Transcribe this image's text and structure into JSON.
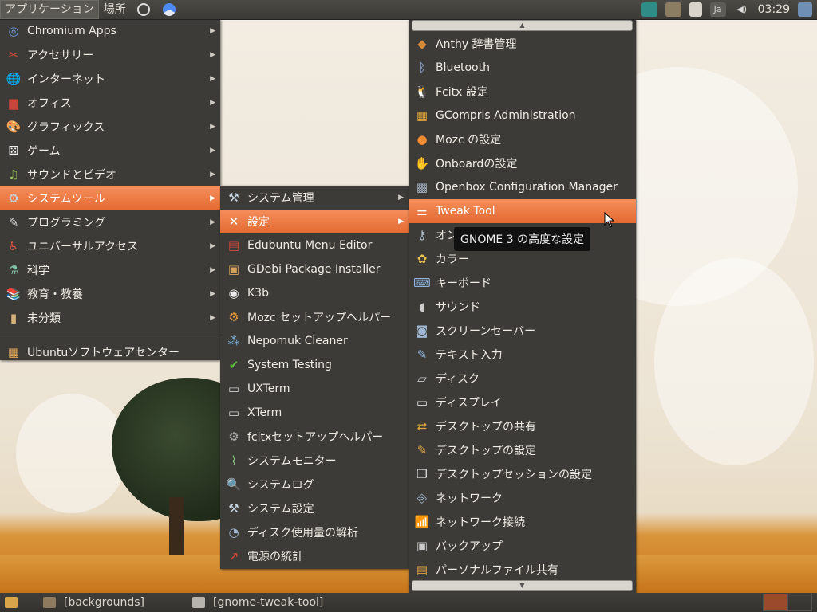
{
  "top_panel": {
    "applications": "アプリケーション",
    "places": "場所",
    "input_lang": "Ja",
    "clock": "03:29"
  },
  "menu_main": {
    "items": [
      {
        "label": "Chromium Apps",
        "icon": "chromium-icon"
      },
      {
        "label": "アクセサリー",
        "icon": "accessories-icon"
      },
      {
        "label": "インターネット",
        "icon": "internet-icon"
      },
      {
        "label": "オフィス",
        "icon": "office-icon"
      },
      {
        "label": "グラフィックス",
        "icon": "graphics-icon"
      },
      {
        "label": "ゲーム",
        "icon": "games-icon"
      },
      {
        "label": "サウンドとビデオ",
        "icon": "sound-video-icon"
      },
      {
        "label": "システムツール",
        "icon": "system-tools-icon"
      },
      {
        "label": "プログラミング",
        "icon": "programming-icon"
      },
      {
        "label": "ユニバーサルアクセス",
        "icon": "universal-access-icon"
      },
      {
        "label": "科学",
        "icon": "science-icon"
      },
      {
        "label": "教育・教養",
        "icon": "education-icon"
      },
      {
        "label": "未分類",
        "icon": "other-icon"
      }
    ],
    "software_center": "Ubuntuソフトウェアセンター"
  },
  "menu_system": {
    "items": [
      {
        "label": "システム管理"
      },
      {
        "label": "設定"
      },
      {
        "label": "Edubuntu Menu Editor"
      },
      {
        "label": "GDebi Package Installer"
      },
      {
        "label": "K3b"
      },
      {
        "label": "Mozc セットアップヘルパー"
      },
      {
        "label": "Nepomuk Cleaner"
      },
      {
        "label": "System Testing"
      },
      {
        "label": "UXTerm"
      },
      {
        "label": "XTerm"
      },
      {
        "label": "fcitxセットアップヘルパー"
      },
      {
        "label": "システムモニター"
      },
      {
        "label": "システムログ"
      },
      {
        "label": "システム設定"
      },
      {
        "label": "ディスク使用量の解析"
      },
      {
        "label": "電源の統計"
      }
    ]
  },
  "menu_settings": {
    "items": [
      {
        "label": "Anthy 辞書管理"
      },
      {
        "label": "Bluetooth"
      },
      {
        "label": "Fcitx 設定"
      },
      {
        "label": "GCompris Administration"
      },
      {
        "label": "Mozc の設定"
      },
      {
        "label": "Onboardの設定"
      },
      {
        "label": "Openbox Configuration Manager"
      },
      {
        "label": "Tweak Tool"
      },
      {
        "label": "オン"
      },
      {
        "label": "カラー"
      },
      {
        "label": "キーボード"
      },
      {
        "label": "サウンド"
      },
      {
        "label": "スクリーンセーバー"
      },
      {
        "label": "テキスト入力"
      },
      {
        "label": "ディスク"
      },
      {
        "label": "ディスプレイ"
      },
      {
        "label": "デスクトップの共有"
      },
      {
        "label": "デスクトップの設定"
      },
      {
        "label": "デスクトップセッションの設定"
      },
      {
        "label": "ネットワーク"
      },
      {
        "label": "ネットワーク接続"
      },
      {
        "label": "バックアップ"
      },
      {
        "label": "パーソナルファイル共有"
      }
    ]
  },
  "tooltip": "GNOME 3 の高度な設定",
  "bottom_panel": {
    "tasks": [
      "[backgrounds]",
      "[gnome-tweak-tool]"
    ]
  },
  "colors": {
    "menu_bg": "#3c3b37",
    "highlight": "#e46a31",
    "panel": "#3b3a36"
  }
}
